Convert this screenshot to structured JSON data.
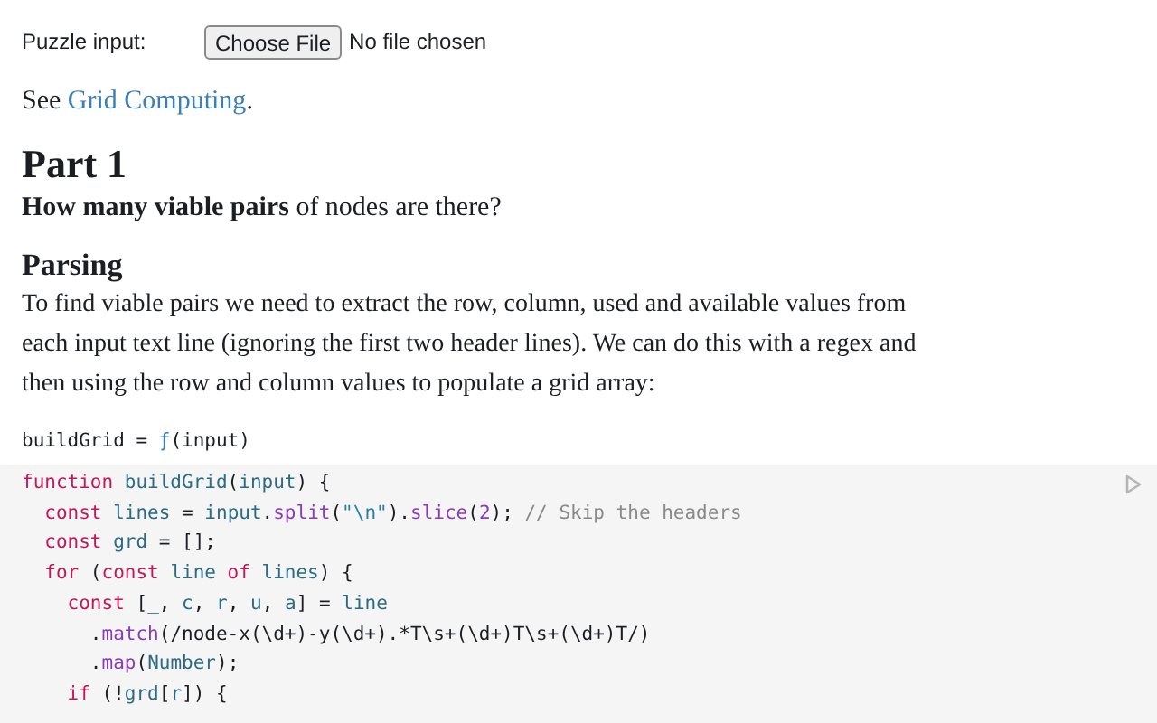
{
  "input_row": {
    "label": "Puzzle input:",
    "button": "Choose File",
    "file_status": "No file chosen"
  },
  "see": {
    "before": "See ",
    "link": "Grid Computing",
    "after": "."
  },
  "part_heading": "Part 1",
  "question": "**How many viable pairs** of nodes are there?",
  "section_heading": "Parsing",
  "paragraph": "To find viable pairs we need to extract the row, column, used and available values from each input text line (ignoring the first two header lines). We can do this with a regex and then using the row and column values to populate a grid array:",
  "cell_header": [
    {
      "text": "buildGrid = ",
      "kind": "plain"
    },
    {
      "text": "ƒ",
      "kind": "fn_mark"
    },
    {
      "text": "(input)",
      "kind": "plain"
    }
  ],
  "code_lines": [
    [
      {
        "text": "function",
        "kind": "kw"
      },
      {
        "text": " buildGrid",
        "kind": "var"
      },
      {
        "text": "(",
        "kind": "plain"
      },
      {
        "text": "input",
        "kind": "var"
      },
      {
        "text": ") {",
        "kind": "plain"
      }
    ],
    [
      {
        "text": "  const",
        "kind": "kw"
      },
      {
        "text": " lines",
        "kind": "var"
      },
      {
        "text": " = ",
        "kind": "plain"
      },
      {
        "text": "input",
        "kind": "var"
      },
      {
        "text": ".",
        "kind": "plain"
      },
      {
        "text": "split",
        "kind": "method"
      },
      {
        "text": "(",
        "kind": "plain"
      },
      {
        "text": "\"\\n\"",
        "kind": "str"
      },
      {
        "text": ").",
        "kind": "plain"
      },
      {
        "text": "slice",
        "kind": "method"
      },
      {
        "text": "(",
        "kind": "plain"
      },
      {
        "text": "2",
        "kind": "num"
      },
      {
        "text": "); ",
        "kind": "plain"
      },
      {
        "text": "// Skip the headers",
        "kind": "comment"
      }
    ],
    [
      {
        "text": "  const",
        "kind": "kw"
      },
      {
        "text": " grd",
        "kind": "var"
      },
      {
        "text": " = [];",
        "kind": "plain"
      }
    ],
    [
      {
        "text": "  for",
        "kind": "kw"
      },
      {
        "text": " (",
        "kind": "plain"
      },
      {
        "text": "const",
        "kind": "kw"
      },
      {
        "text": " line",
        "kind": "var"
      },
      {
        "text": " of",
        "kind": "kw"
      },
      {
        "text": " lines",
        "kind": "var"
      },
      {
        "text": ") {",
        "kind": "plain"
      }
    ],
    [
      {
        "text": "    const",
        "kind": "kw"
      },
      {
        "text": " [",
        "kind": "plain"
      },
      {
        "text": "_",
        "kind": "var"
      },
      {
        "text": ", ",
        "kind": "plain"
      },
      {
        "text": "c",
        "kind": "var"
      },
      {
        "text": ", ",
        "kind": "plain"
      },
      {
        "text": "r",
        "kind": "var"
      },
      {
        "text": ", ",
        "kind": "plain"
      },
      {
        "text": "u",
        "kind": "var"
      },
      {
        "text": ", ",
        "kind": "plain"
      },
      {
        "text": "a",
        "kind": "var"
      },
      {
        "text": "] = ",
        "kind": "plain"
      },
      {
        "text": "line",
        "kind": "var"
      }
    ],
    [
      {
        "text": "      .",
        "kind": "plain"
      },
      {
        "text": "match",
        "kind": "method"
      },
      {
        "text": "(",
        "kind": "plain"
      },
      {
        "text": "/node-x(\\d+)-y(\\d+).*T\\s+(\\d+)T\\s+(\\d+)T/",
        "kind": "regex"
      },
      {
        "text": ")",
        "kind": "plain"
      }
    ],
    [
      {
        "text": "      .",
        "kind": "plain"
      },
      {
        "text": "map",
        "kind": "method"
      },
      {
        "text": "(",
        "kind": "plain"
      },
      {
        "text": "Number",
        "kind": "var"
      },
      {
        "text": ");",
        "kind": "plain"
      }
    ],
    [
      {
        "text": "    if",
        "kind": "kw"
      },
      {
        "text": " (!",
        "kind": "plain"
      },
      {
        "text": "grd",
        "kind": "var"
      },
      {
        "text": "[",
        "kind": "plain"
      },
      {
        "text": "r",
        "kind": "var"
      },
      {
        "text": "]) {",
        "kind": "plain"
      }
    ]
  ]
}
